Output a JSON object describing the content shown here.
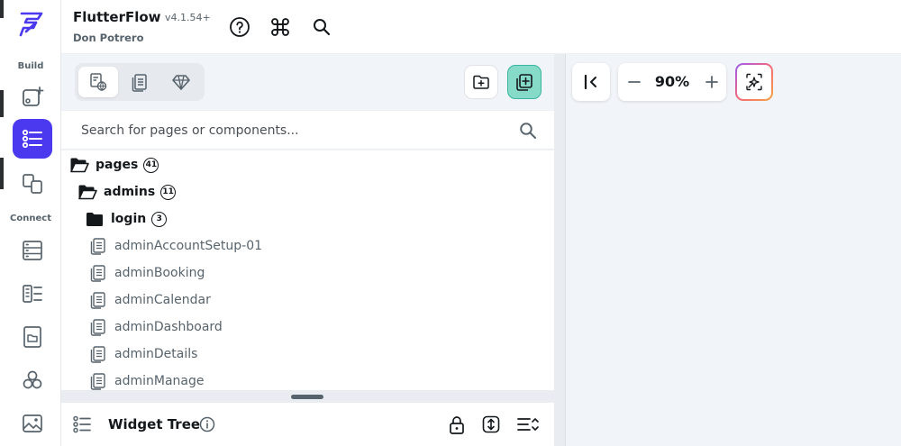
{
  "app": {
    "title": "FlutterFlow",
    "version": "v4.1.54+",
    "user": "Don Potrero"
  },
  "rail": {
    "build_label": "Build",
    "connect_label": "Connect",
    "items": [
      {
        "icon": "add-widget-icon",
        "active": false
      },
      {
        "icon": "page-list-icon",
        "active": true
      },
      {
        "icon": "storyboard-icon",
        "active": false
      },
      {
        "icon": "database-icon",
        "active": false
      },
      {
        "icon": "api-calls-icon",
        "active": false
      },
      {
        "icon": "media-folder-icon",
        "active": false
      },
      {
        "icon": "integrations-icon",
        "active": false
      },
      {
        "icon": "image-assets-icon",
        "active": false
      }
    ]
  },
  "search": {
    "placeholder": "Search for pages or components..."
  },
  "tree": {
    "folders": [
      {
        "label": "pages",
        "count": "41"
      },
      {
        "label": "admins",
        "count": "11"
      },
      {
        "label": "login",
        "count": "3"
      }
    ],
    "pages": [
      "adminAccountSetup-01",
      "adminBooking",
      "adminCalendar",
      "adminDashboard",
      "adminDetails",
      "adminManage"
    ]
  },
  "widget_tree": {
    "label": "Widget Tree"
  },
  "canvas": {
    "zoom": "90%"
  },
  "colors": {
    "accent": "#4b39ef",
    "teal": "#85dbc8",
    "panel_bg": "#f1f4f8"
  }
}
